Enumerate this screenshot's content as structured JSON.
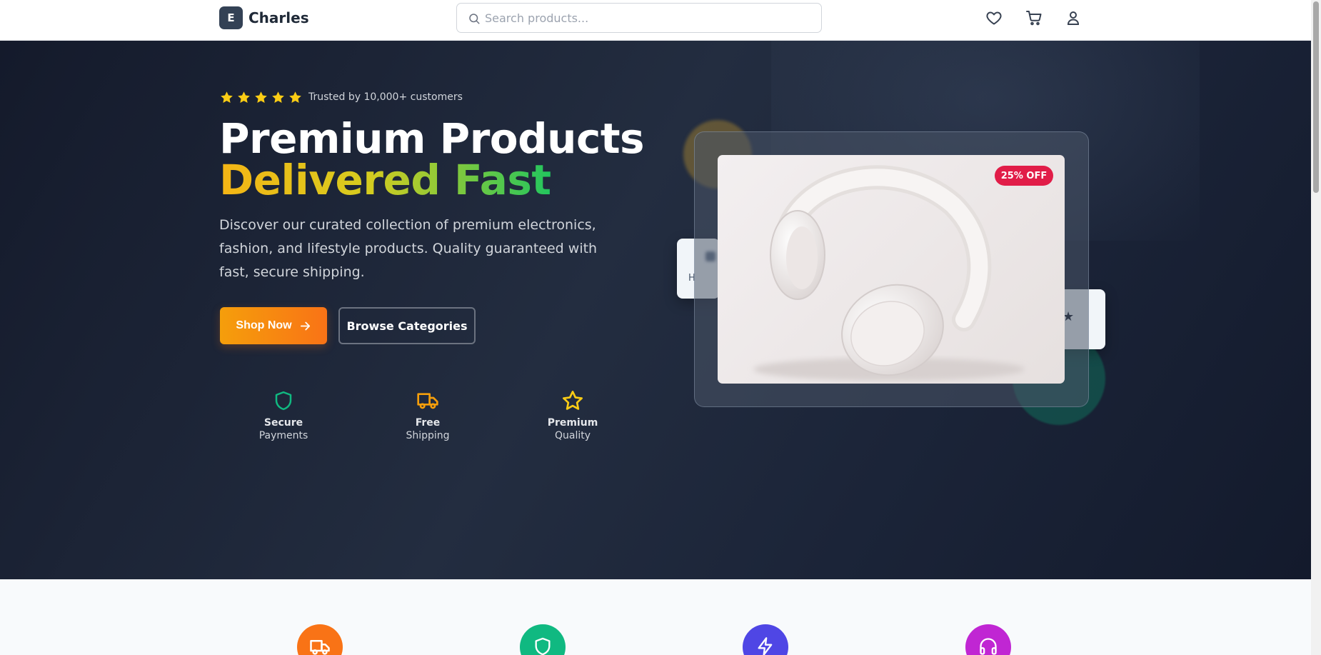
{
  "header": {
    "logo_letter": "E",
    "brand": "Charles",
    "search_placeholder": "Search products...",
    "icons": [
      "heart-icon",
      "cart-icon",
      "user-icon"
    ]
  },
  "hero": {
    "rating_stars": 5,
    "trusted_text": "Trusted by 10,000+ customers",
    "title_line1": "Premium Products",
    "title_line2": "Delivered Fast",
    "description": "Discover our curated collection of premium electronics, fashion, and lifestyle products. Quality guaranteed with fast, secure shipping.",
    "primary_button": "Shop Now",
    "secondary_button": "Browse Categories",
    "features": [
      {
        "title": "Secure",
        "subtitle": "Payments",
        "icon": "shield-icon",
        "color": "#10b981"
      },
      {
        "title": "Free",
        "subtitle": "Shipping",
        "icon": "truck-icon",
        "color": "#f59e0b"
      },
      {
        "title": "Premium",
        "subtitle": "Quality",
        "icon": "star-icon",
        "color": "#facc15"
      }
    ],
    "product": {
      "image": "white headphones",
      "badge": "25% OFF"
    },
    "floating_left_label": "H",
    "floating_right_label": "★"
  },
  "services": [
    {
      "icon": "truck-icon",
      "color": "#f97316"
    },
    {
      "icon": "shield-icon",
      "color": "#10b981"
    },
    {
      "icon": "lightning-icon",
      "color": "#4f46e5"
    },
    {
      "icon": "headphones-icon",
      "color": "#c026d3"
    }
  ],
  "colors": {
    "accent_orange": "#f97316",
    "accent_yellow": "#facc15",
    "accent_green": "#22c55e",
    "badge_red": "#e11d48",
    "hero_dark": "#1e293b"
  }
}
